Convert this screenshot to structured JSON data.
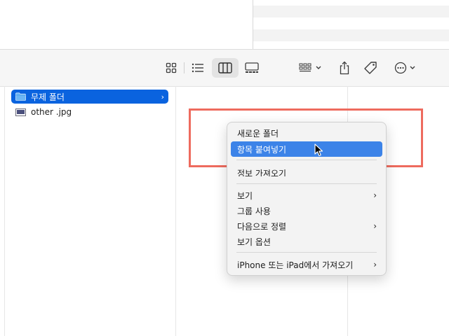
{
  "toolbar": {
    "buttons": [
      {
        "name": "icon-view-button",
        "icon": "grid-icon"
      },
      {
        "name": "list-view-button",
        "icon": "list-icon"
      },
      {
        "name": "column-view-button",
        "icon": "columns-icon",
        "active": true
      },
      {
        "name": "gallery-view-button",
        "icon": "gallery-icon"
      },
      {
        "name": "group-button",
        "icon": "group-icon"
      },
      {
        "name": "share-button",
        "icon": "share-icon"
      },
      {
        "name": "tag-button",
        "icon": "tag-icon"
      },
      {
        "name": "more-button",
        "icon": "ellipsis-circle-icon"
      }
    ]
  },
  "files": [
    {
      "name": "무제 폴더",
      "type": "folder",
      "selected": true
    },
    {
      "name": "other .jpg",
      "type": "image",
      "selected": false
    }
  ],
  "context_menu": {
    "items": [
      {
        "label": "새로운 폴더",
        "submenu": false,
        "highlighted": false
      },
      {
        "label": "항목 붙여넣기",
        "submenu": false,
        "highlighted": true
      },
      {
        "label": "정보 가져오기",
        "submenu": false,
        "highlighted": false
      },
      {
        "label": "보기",
        "submenu": true,
        "highlighted": false
      },
      {
        "label": "그룹 사용",
        "submenu": false,
        "highlighted": false
      },
      {
        "label": "다음으로 정렬",
        "submenu": true,
        "highlighted": false
      },
      {
        "label": "보기 옵션",
        "submenu": false,
        "highlighted": false
      },
      {
        "label": "iPhone 또는 iPad에서 가져오기",
        "submenu": true,
        "highlighted": false
      }
    ],
    "submenu_glyph": "›"
  },
  "colors": {
    "selection": "#0a63df",
    "menu_highlight": "#3c83e8",
    "annotation_box": "#ee6b5e"
  }
}
